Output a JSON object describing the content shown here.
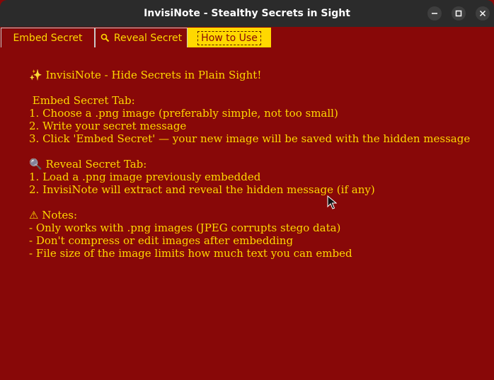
{
  "window": {
    "title": "InvisiNote - Stealthy Secrets in Sight",
    "buttons": [
      "minimize-icon",
      "maximize-icon",
      "close-icon"
    ]
  },
  "tabs": [
    {
      "label": "Embed Secret",
      "icon": null,
      "active": false
    },
    {
      "label": "Reveal Secret",
      "icon": "magnifier-icon",
      "active": false
    },
    {
      "label": "How to Use",
      "icon": null,
      "active": true
    }
  ],
  "content": {
    "heading": "✨ InvisiNote - Hide Secrets in Plain Sight!",
    "embed_title": " Embed Secret Tab:",
    "embed_steps": [
      "1. Choose a .png image (preferably simple, not too small)",
      "2. Write your secret message",
      "3. Click 'Embed Secret' — your new image will be saved with the hidden message"
    ],
    "reveal_title": "🔍 Reveal Secret Tab:",
    "reveal_steps": [
      "1. Load a .png image previously embedded",
      "2. InvisiNote will extract and reveal the hidden message (if any)"
    ],
    "notes_title": "⚠ Notes:",
    "notes": [
      "- Only works with .png images (JPEG corrupts stego data)",
      "- Don't compress or edit images after embedding",
      "- File size of the image limits how much text you can embed"
    ]
  },
  "colors": {
    "background": "#880808",
    "text": "#ffd700",
    "active_tab": "#ffd800",
    "titlebar": "#2b2b2b"
  }
}
